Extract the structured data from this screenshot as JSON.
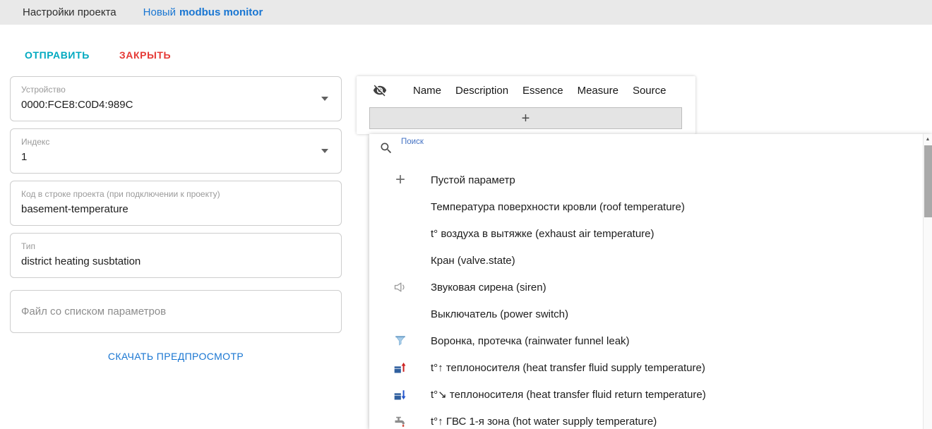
{
  "header": {
    "title": "Настройки проекта",
    "link_prefix": "Новый",
    "link_bold": "modbus monitor"
  },
  "toolbar": {
    "send": "ОТПРАВИТЬ",
    "close": "ЗАКРЫТЬ"
  },
  "form": {
    "fields": [
      {
        "label": "Устройство",
        "value": "0000:FCE8:C0D4:989C",
        "dropdown": true
      },
      {
        "label": "Индекс",
        "value": "1",
        "dropdown": true
      },
      {
        "label": "Код в строке проекта (при подключении к проекту)",
        "value": "basement-temperature",
        "dropdown": false
      },
      {
        "label": "Тип",
        "value": "district heating susbtation",
        "dropdown": false
      },
      {
        "placeholder": "Файл со списком параметров"
      }
    ],
    "download_link": "СКАЧАТЬ ПРЕДПРОСМОТР"
  },
  "table": {
    "columns": [
      "Name",
      "Description",
      "Essence",
      "Measure",
      "Source"
    ],
    "add_label": "+"
  },
  "dropdown": {
    "search_label": "Поиск",
    "items": [
      {
        "icon": "plus",
        "label": "Пустой параметр"
      },
      {
        "icon": "",
        "label": "Температура поверхности кровли (roof temperature)"
      },
      {
        "icon": "",
        "label": "t° воздуха в вытяжке (exhaust air temperature)"
      },
      {
        "icon": "",
        "label": "Кран (valve.state)"
      },
      {
        "icon": "siren",
        "label": "Звуковая сирена (siren)"
      },
      {
        "icon": "",
        "label": "Выключатель (power switch)"
      },
      {
        "icon": "funnel",
        "label": "Воронка, протечка (rainwater funnel leak)"
      },
      {
        "icon": "heat-supply",
        "label": "t°↑ теплоносителя (heat transfer fluid supply temperature)"
      },
      {
        "icon": "heat-return",
        "label": "t°↘ теплоносителя (heat transfer fluid return temperature)"
      },
      {
        "icon": "hot-water",
        "label": "t°↑ ГВС 1-я зона (hot water supply temperature)"
      }
    ]
  },
  "colors": {
    "accent_blue": "#1976d2",
    "send_teal": "#00a9c0",
    "close_red": "#e53935",
    "topbar_gray": "#e9e9e9"
  }
}
